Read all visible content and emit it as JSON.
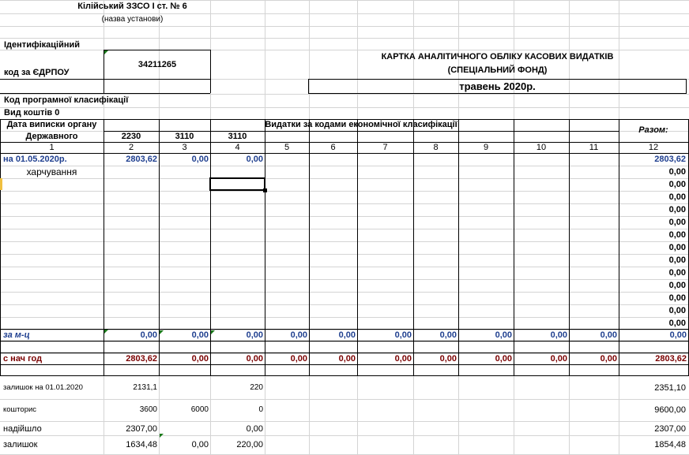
{
  "header": {
    "institution": "Кілійський ЗЗСО І ст. № 6",
    "institution_caption": "(назва установи)",
    "ident_label": "Ідентифікаційний",
    "edrpou_label": "код за ЄДРПОУ",
    "edrpou_code": "34211265",
    "card_title_1": "КАРТКА  АНАЛІТИЧНОГО  ОБЛІКУ  КАСОВИХ  ВИДАТКІВ",
    "card_title_2": "(СПЕЦІАЛЬНИЙ ФОНД)",
    "month": "травень 2020р.",
    "program_code_label": "Код програмної класифікації",
    "fund_type_label": "Вид коштів   0"
  },
  "table": {
    "col1_header_1": "Дата виписки органу",
    "col1_header_2": "Державного",
    "expenses_header": "Видатки за кодами економічної класифікації",
    "total_header": "Разом:",
    "codes": [
      "2230",
      "3110",
      "3110"
    ],
    "col_numbers": [
      "1",
      "2",
      "3",
      "4",
      "5",
      "6",
      "7",
      "8",
      "9",
      "10",
      "11",
      "12"
    ],
    "opening_row": {
      "label": "на 01.05.2020р.",
      "c2": "2803,62",
      "c3": "0,00",
      "c4": "0,00",
      "total": "2803,62"
    },
    "item_label": "харчування",
    "row_totals": [
      "0,00",
      "0,00",
      "0,00",
      "0,00",
      "0,00",
      "0,00",
      "0,00",
      "0,00",
      "0,00",
      "0,00",
      "0,00",
      "0,00",
      "0,00"
    ],
    "month_row": {
      "label": "за м-ц",
      "values": [
        "0,00",
        "0,00",
        "0,00",
        "0,00",
        "0,00",
        "0,00",
        "0,00",
        "0,00",
        "0,00",
        "0,00",
        "0,00"
      ]
    },
    "ytd_row": {
      "label": "с нач год",
      "values": [
        "2803,62",
        "0,00",
        "0,00",
        "0,00",
        "0,00",
        "0,00",
        "0,00",
        "0,00",
        "0,00",
        "0,00",
        "2803,62"
      ]
    }
  },
  "summary": {
    "balance_label": "залишок на 01.01.2020",
    "balance_c2": "2131,1",
    "balance_c4": "220",
    "balance_total": "2351,10",
    "estimate_label": "кошторис",
    "estimate_c2": "3600",
    "estimate_c3": "6000",
    "estimate_c4": "0",
    "estimate_total": "9600,00",
    "received_label": "надійшло",
    "received_c2": "2307,00",
    "received_c4": "0,00",
    "received_total": "2307,00",
    "remaining_label": "залишок",
    "remaining_c2": "1634,48",
    "remaining_c3": "0,00",
    "remaining_c4": "220,00",
    "remaining_total": "1854,48"
  }
}
